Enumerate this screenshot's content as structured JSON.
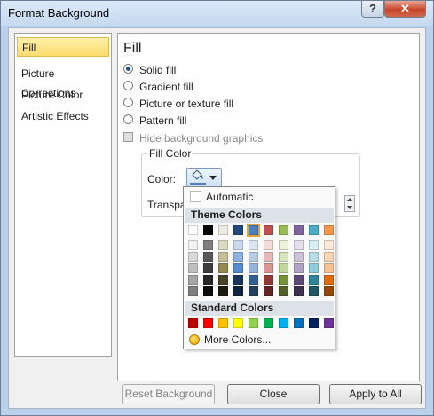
{
  "window": {
    "title": "Format Background",
    "help_glyph": "?",
    "close_glyph": "✕"
  },
  "nav": {
    "items": [
      {
        "label": "Fill",
        "selected": true
      },
      {
        "label": "Picture Corrections"
      },
      {
        "label": "Picture Color"
      },
      {
        "label": "Artistic Effects"
      }
    ]
  },
  "panel": {
    "title": "Fill",
    "options": {
      "solid": {
        "label": "Solid fill",
        "checked": true
      },
      "gradient": {
        "label": "Gradient fill"
      },
      "picture": {
        "label": "Picture or texture fill"
      },
      "pattern": {
        "label": "Pattern fill"
      }
    },
    "hide_graphics": {
      "label": "Hide background graphics",
      "disabled": true
    },
    "fill_color": {
      "group_label": "Fill Color",
      "color_label": "Color:",
      "transparency_label": "Transpa",
      "current_color": "#4f81bd"
    }
  },
  "popup": {
    "automatic_label": "Automatic",
    "theme_header": "Theme Colors",
    "standard_header": "Standard Colors",
    "more_colors_label": "More Colors...",
    "theme_top": [
      "#ffffff",
      "#000000",
      "#eeece1",
      "#1f497d",
      "#4f81bd",
      "#c0504d",
      "#9bbb59",
      "#8064a2",
      "#4bacc6",
      "#f79646"
    ],
    "theme_shades": [
      [
        "#f2f2f2",
        "#7f7f7f",
        "#ddd9c3",
        "#c6d9f0",
        "#dbe5f1",
        "#f2dcdb",
        "#ebf1dd",
        "#e5e0ec",
        "#dbeef3",
        "#fdeada"
      ],
      [
        "#d8d8d8",
        "#595959",
        "#c4bd97",
        "#8db3e2",
        "#b8cce4",
        "#e5b9b7",
        "#d7e3bc",
        "#ccc1d9",
        "#b7dde8",
        "#fbd5b5"
      ],
      [
        "#bfbfbf",
        "#3f3f3f",
        "#938953",
        "#548dd4",
        "#95b3d7",
        "#d99694",
        "#c3d69b",
        "#b2a2c7",
        "#92cddc",
        "#fac08f"
      ],
      [
        "#a5a5a5",
        "#262626",
        "#494429",
        "#17365d",
        "#366092",
        "#953734",
        "#76923c",
        "#5f497a",
        "#31859b",
        "#e36c09"
      ],
      [
        "#7f7f7f",
        "#0c0c0c",
        "#1d1b10",
        "#0f243e",
        "#244061",
        "#632423",
        "#4f6128",
        "#3f3151",
        "#205867",
        "#974806"
      ]
    ],
    "standard": [
      "#c00000",
      "#ff0000",
      "#ffc000",
      "#ffff00",
      "#92d050",
      "#00b050",
      "#00b0f0",
      "#0070c0",
      "#002060",
      "#7030a0"
    ],
    "selected_theme_index": 4
  },
  "buttons": {
    "reset": "Reset Background",
    "close": "Close",
    "apply_all": "Apply to All"
  }
}
